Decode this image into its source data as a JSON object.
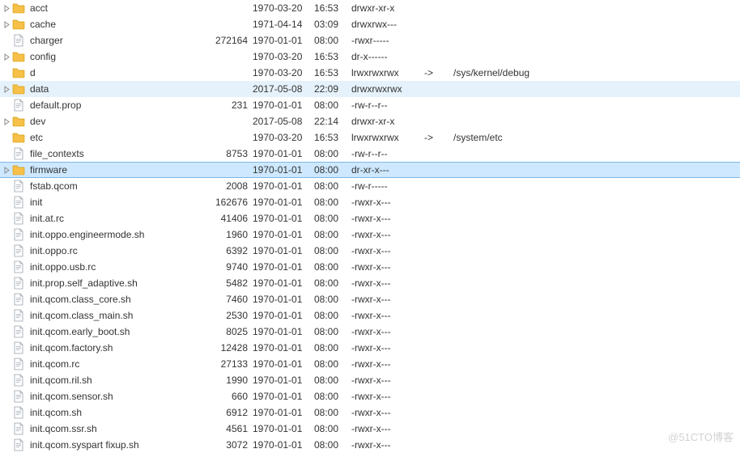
{
  "watermark": "@51CTO博客",
  "rows": [
    {
      "expandable": true,
      "type": "folder",
      "name": "acct",
      "size": "",
      "date": "1970-03-20",
      "time": "16:53",
      "perm": "drwxr-xr-x",
      "sep": "",
      "target": ""
    },
    {
      "expandable": true,
      "type": "folder",
      "name": "cache",
      "size": "",
      "date": "1971-04-14",
      "time": "03:09",
      "perm": "drwxrwx---",
      "sep": "",
      "target": ""
    },
    {
      "expandable": false,
      "type": "file",
      "name": "charger",
      "size": "272164",
      "date": "1970-01-01",
      "time": "08:00",
      "perm": "-rwxr-----",
      "sep": "",
      "target": ""
    },
    {
      "expandable": true,
      "type": "folder",
      "name": "config",
      "size": "",
      "date": "1970-03-20",
      "time": "16:53",
      "perm": "dr-x------",
      "sep": "",
      "target": ""
    },
    {
      "expandable": false,
      "type": "folder",
      "name": "d",
      "size": "",
      "date": "1970-03-20",
      "time": "16:53",
      "perm": "lrwxrwxrwx",
      "sep": "->",
      "target": "/sys/kernel/debug"
    },
    {
      "expandable": true,
      "type": "folder",
      "name": "data",
      "size": "",
      "date": "2017-05-08",
      "time": "22:09",
      "perm": "drwxrwxrwx",
      "sep": "",
      "target": "",
      "highlight": true
    },
    {
      "expandable": false,
      "type": "file",
      "name": "default.prop",
      "size": "231",
      "date": "1970-01-01",
      "time": "08:00",
      "perm": "-rw-r--r--",
      "sep": "",
      "target": ""
    },
    {
      "expandable": true,
      "type": "folder",
      "name": "dev",
      "size": "",
      "date": "2017-05-08",
      "time": "22:14",
      "perm": "drwxr-xr-x",
      "sep": "",
      "target": ""
    },
    {
      "expandable": false,
      "type": "folder",
      "name": "etc",
      "size": "",
      "date": "1970-03-20",
      "time": "16:53",
      "perm": "lrwxrwxrwx",
      "sep": "->",
      "target": "/system/etc"
    },
    {
      "expandable": false,
      "type": "file",
      "name": "file_contexts",
      "size": "8753",
      "date": "1970-01-01",
      "time": "08:00",
      "perm": "-rw-r--r--",
      "sep": "",
      "target": ""
    },
    {
      "expandable": true,
      "type": "folder",
      "name": "firmware",
      "size": "",
      "date": "1970-01-01",
      "time": "08:00",
      "perm": "dr-xr-x---",
      "sep": "",
      "target": "",
      "selected": true
    },
    {
      "expandable": false,
      "type": "file",
      "name": "fstab.qcom",
      "size": "2008",
      "date": "1970-01-01",
      "time": "08:00",
      "perm": "-rw-r-----",
      "sep": "",
      "target": ""
    },
    {
      "expandable": false,
      "type": "file",
      "name": "init",
      "size": "162676",
      "date": "1970-01-01",
      "time": "08:00",
      "perm": "-rwxr-x---",
      "sep": "",
      "target": ""
    },
    {
      "expandable": false,
      "type": "file",
      "name": "init.at.rc",
      "size": "41406",
      "date": "1970-01-01",
      "time": "08:00",
      "perm": "-rwxr-x---",
      "sep": "",
      "target": ""
    },
    {
      "expandable": false,
      "type": "file",
      "name": "init.oppo.engineermode.sh",
      "size": "1960",
      "date": "1970-01-01",
      "time": "08:00",
      "perm": "-rwxr-x---",
      "sep": "",
      "target": ""
    },
    {
      "expandable": false,
      "type": "file",
      "name": "init.oppo.rc",
      "size": "6392",
      "date": "1970-01-01",
      "time": "08:00",
      "perm": "-rwxr-x---",
      "sep": "",
      "target": ""
    },
    {
      "expandable": false,
      "type": "file",
      "name": "init.oppo.usb.rc",
      "size": "9740",
      "date": "1970-01-01",
      "time": "08:00",
      "perm": "-rwxr-x---",
      "sep": "",
      "target": ""
    },
    {
      "expandable": false,
      "type": "file",
      "name": "init.prop.self_adaptive.sh",
      "size": "5482",
      "date": "1970-01-01",
      "time": "08:00",
      "perm": "-rwxr-x---",
      "sep": "",
      "target": ""
    },
    {
      "expandable": false,
      "type": "file",
      "name": "init.qcom.class_core.sh",
      "size": "7460",
      "date": "1970-01-01",
      "time": "08:00",
      "perm": "-rwxr-x---",
      "sep": "",
      "target": ""
    },
    {
      "expandable": false,
      "type": "file",
      "name": "init.qcom.class_main.sh",
      "size": "2530",
      "date": "1970-01-01",
      "time": "08:00",
      "perm": "-rwxr-x---",
      "sep": "",
      "target": ""
    },
    {
      "expandable": false,
      "type": "file",
      "name": "init.qcom.early_boot.sh",
      "size": "8025",
      "date": "1970-01-01",
      "time": "08:00",
      "perm": "-rwxr-x---",
      "sep": "",
      "target": ""
    },
    {
      "expandable": false,
      "type": "file",
      "name": "init.qcom.factory.sh",
      "size": "12428",
      "date": "1970-01-01",
      "time": "08:00",
      "perm": "-rwxr-x---",
      "sep": "",
      "target": ""
    },
    {
      "expandable": false,
      "type": "file",
      "name": "init.qcom.rc",
      "size": "27133",
      "date": "1970-01-01",
      "time": "08:00",
      "perm": "-rwxr-x---",
      "sep": "",
      "target": ""
    },
    {
      "expandable": false,
      "type": "file",
      "name": "init.qcom.ril.sh",
      "size": "1990",
      "date": "1970-01-01",
      "time": "08:00",
      "perm": "-rwxr-x---",
      "sep": "",
      "target": ""
    },
    {
      "expandable": false,
      "type": "file",
      "name": "init.qcom.sensor.sh",
      "size": "660",
      "date": "1970-01-01",
      "time": "08:00",
      "perm": "-rwxr-x---",
      "sep": "",
      "target": ""
    },
    {
      "expandable": false,
      "type": "file",
      "name": "init.qcom.sh",
      "size": "6912",
      "date": "1970-01-01",
      "time": "08:00",
      "perm": "-rwxr-x---",
      "sep": "",
      "target": ""
    },
    {
      "expandable": false,
      "type": "file",
      "name": "init.qcom.ssr.sh",
      "size": "4561",
      "date": "1970-01-01",
      "time": "08:00",
      "perm": "-rwxr-x---",
      "sep": "",
      "target": ""
    },
    {
      "expandable": false,
      "type": "file",
      "name": "init.qcom.syspart fixup.sh",
      "size": "3072",
      "date": "1970-01-01",
      "time": "08:00",
      "perm": "-rwxr-x---",
      "sep": "",
      "target": ""
    }
  ]
}
